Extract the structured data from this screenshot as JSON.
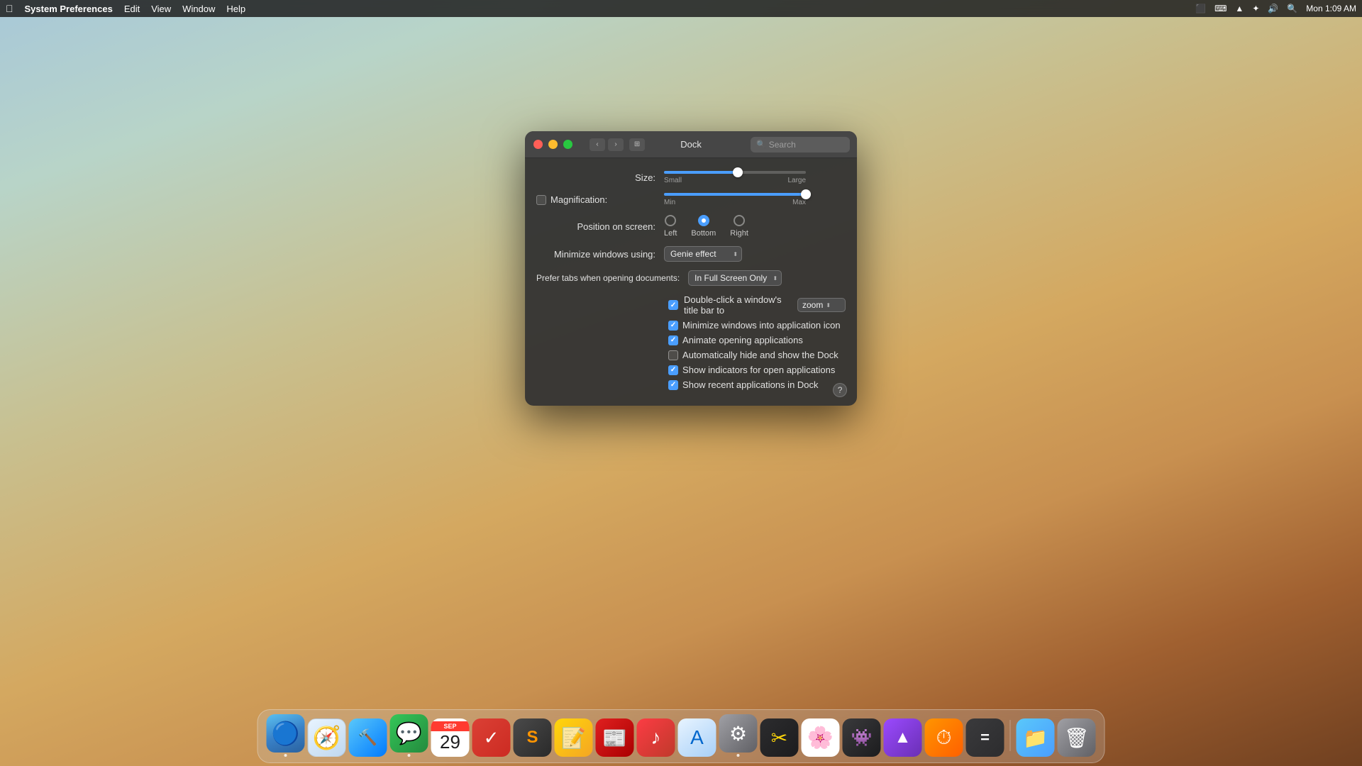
{
  "desktop": {},
  "menubar": {
    "apple": "⌘",
    "app_name": "System Preferences",
    "menu_items": [
      "Edit",
      "View",
      "Window",
      "Help"
    ],
    "time": "Mon 1:09 AM",
    "right_icons": [
      "screen",
      "keyboard",
      "wifi",
      "bluetooth",
      "wifi2",
      "search"
    ]
  },
  "window": {
    "title": "Dock",
    "search_placeholder": "Search",
    "size_label": "Size:",
    "size_small": "Small",
    "size_large": "Large",
    "magnification_label": "Magnification:",
    "magnification_min": "Min",
    "magnification_max": "Max",
    "position_label": "Position on screen:",
    "position_left": "Left",
    "position_bottom": "Bottom",
    "position_right": "Right",
    "minimize_label": "Minimize windows using:",
    "minimize_value": "Genie effect",
    "tabs_label": "Prefer tabs when opening documents:",
    "tabs_value": "In Full Screen Only",
    "double_click_label": "Double-click a window's title bar to",
    "double_click_value": "zoom",
    "checkboxes": [
      {
        "id": "minimize_app",
        "label": "Minimize windows into application icon",
        "checked": true
      },
      {
        "id": "animate",
        "label": "Animate opening applications",
        "checked": true
      },
      {
        "id": "autohide",
        "label": "Automatically hide and show the Dock",
        "checked": false
      },
      {
        "id": "indicators",
        "label": "Show indicators for open applications",
        "checked": true
      },
      {
        "id": "recent",
        "label": "Show recent applications in Dock",
        "checked": true
      }
    ]
  },
  "dock": {
    "items": [
      {
        "id": "finder",
        "label": "Finder",
        "icon": "🔵",
        "has_dot": true
      },
      {
        "id": "safari",
        "label": "Safari",
        "icon": "🧭",
        "has_dot": false
      },
      {
        "id": "xcode",
        "label": "Xcode",
        "icon": "🔨",
        "has_dot": false
      },
      {
        "id": "messages",
        "label": "Messages",
        "icon": "💬",
        "has_dot": true
      },
      {
        "id": "calendar",
        "label": "Calendar",
        "icon": "📅",
        "has_dot": false
      },
      {
        "id": "todoist",
        "label": "Todoist",
        "icon": "✓",
        "has_dot": false
      },
      {
        "id": "sublime",
        "label": "Sublime Text",
        "icon": "S",
        "has_dot": false
      },
      {
        "id": "notes",
        "label": "Notes",
        "icon": "📝",
        "has_dot": false
      },
      {
        "id": "news",
        "label": "News",
        "icon": "📰",
        "has_dot": false
      },
      {
        "id": "music",
        "label": "Music",
        "icon": "♪",
        "has_dot": false
      },
      {
        "id": "appstore",
        "label": "App Store",
        "icon": "A",
        "has_dot": false
      },
      {
        "id": "sysprefs",
        "label": "System Preferences",
        "icon": "⚙",
        "has_dot": true
      },
      {
        "id": "finalcut",
        "label": "Final Cut Pro",
        "icon": "✂",
        "has_dot": false
      },
      {
        "id": "photos",
        "label": "Photos",
        "icon": "🌸",
        "has_dot": false
      },
      {
        "id": "instastats",
        "label": "InstaStat",
        "icon": "👾",
        "has_dot": false
      },
      {
        "id": "affinity",
        "label": "Affinity Photo",
        "icon": "▲",
        "has_dot": false
      },
      {
        "id": "timing",
        "label": "Timing",
        "icon": "⏱",
        "has_dot": false
      },
      {
        "id": "calculator",
        "label": "Calculator",
        "icon": "=",
        "has_dot": false
      },
      {
        "id": "folder",
        "label": "Downloads",
        "icon": "📁",
        "has_dot": false
      },
      {
        "id": "trash",
        "label": "Trash",
        "icon": "🗑",
        "has_dot": false
      }
    ]
  }
}
